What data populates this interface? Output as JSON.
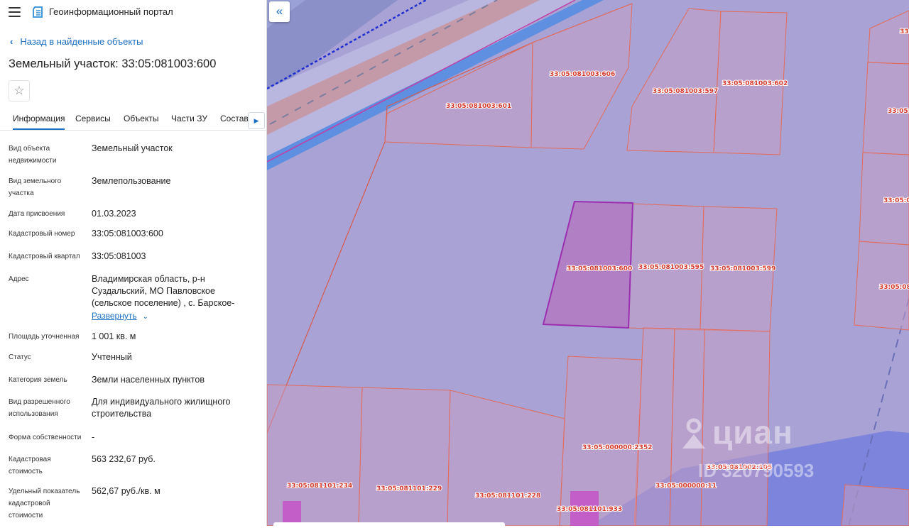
{
  "header": {
    "app_title": "Геоинформационный портал"
  },
  "back_link": {
    "label": "Назад в найденные объекты"
  },
  "object_title": "Земельный участок: 33:05:081003:600",
  "tabs": [
    {
      "label": "Информация"
    },
    {
      "label": "Сервисы"
    },
    {
      "label": "Объекты"
    },
    {
      "label": "Части ЗУ"
    },
    {
      "label": "Состав"
    }
  ],
  "fields": {
    "object_type": {
      "label": "Вид объекта недвижимости",
      "value": "Земельный участок"
    },
    "parcel_type": {
      "label": "Вид земельного участка",
      "value": "Землепользование"
    },
    "assign_date": {
      "label": "Дата присвоения",
      "value": "01.03.2023"
    },
    "cadastral_number": {
      "label": "Кадастровый номер",
      "value": "33:05:081003:600"
    },
    "cadastral_quarter": {
      "label": "Кадастровый квартал",
      "value": "33:05:081003"
    },
    "address": {
      "label": "Адрес",
      "value": "Владимирская область, р-н Суздальский, МО Павловское (сельское поселение) , с. Барское-",
      "expand_label": "Развернуть"
    },
    "area": {
      "label": "Площадь уточненная",
      "value": "1 001 кв. м"
    },
    "status": {
      "label": "Статус",
      "value": "Учтенный"
    },
    "land_category": {
      "label": "Категория земель",
      "value": "Земли населенных пунктов"
    },
    "permitted_use": {
      "label": "Вид разрешенного использования",
      "value": "Для индивидуального жилищного строительства"
    },
    "ownership": {
      "label": "Форма собственности",
      "value": "-"
    },
    "cadastral_value": {
      "label": "Кадастровая стоимость",
      "value": "563 232,67 руб."
    },
    "specific_value": {
      "label": "Удельный показатель кадастровой стоимости",
      "value": "562,67 руб./кв. м"
    }
  },
  "map": {
    "parcel_labels": [
      "33:05:081003:606",
      "33:05:081003:601",
      "33:05:081003:597",
      "33:05:081003:602",
      "33:05:081003:600",
      "33:05:081003:595",
      "33:05:081003:599",
      "33:05:000000:2352",
      "33:05:081002:105",
      "33:05:000000:11",
      "33:05:081101:234",
      "33:05:081101:229",
      "33:05:081101:228",
      "33:05:081101:933",
      "33:05",
      "33:05:",
      "33:05:0",
      "33:05:081"
    ],
    "watermark_brand": "циан",
    "watermark_id": "ID 320790593",
    "colors": {
      "base_fill": "#a9a2d4",
      "selected_fill": "#b07fc4",
      "selected_stroke": "#9c2fb0",
      "parcel_stroke": "#e36b5a",
      "road": "#8fa8e0"
    }
  },
  "icons": [
    "menu-icon",
    "portal-logo-icon",
    "chevron-left-icon",
    "star-icon",
    "chevron-right-icon",
    "chevron-down-icon",
    "double-chevron-left-icon"
  ]
}
